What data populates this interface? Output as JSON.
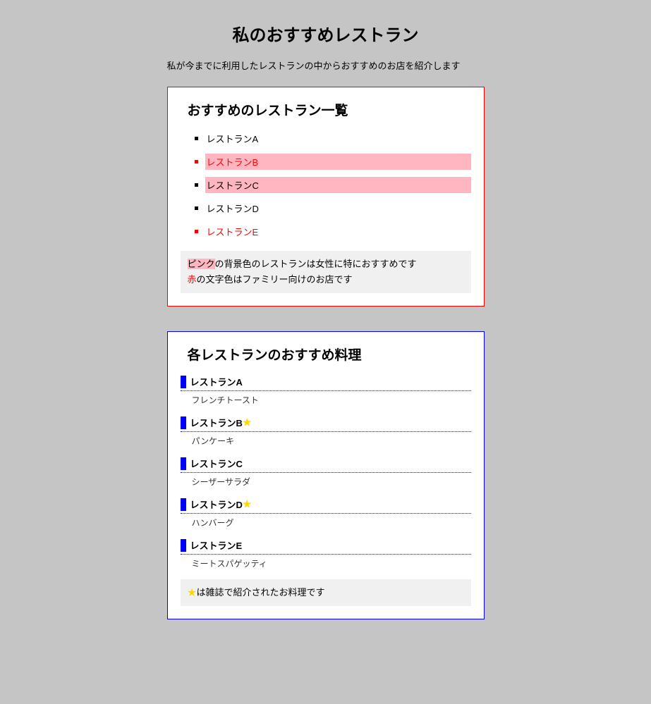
{
  "title": "私のおすすめレストラン",
  "intro": "私が今までに利用したレストランの中からおすすめのお店を紹介します",
  "section1": {
    "heading": "おすすめのレストラン一覧",
    "items": [
      {
        "name": "レストランA",
        "pinkBg": false,
        "redText": false
      },
      {
        "name": "レストランB",
        "pinkBg": true,
        "redText": true
      },
      {
        "name": "レストランC",
        "pinkBg": true,
        "redText": false
      },
      {
        "name": "レストランD",
        "pinkBg": false,
        "redText": false
      },
      {
        "name": "レストランE",
        "pinkBg": false,
        "redText": true
      }
    ],
    "note": {
      "pinkWord": "ピンク",
      "line1Rest": "の背景色のレストランは女性に特におすすめです",
      "redWord": "赤",
      "line2Rest": "の文字色はファミリー向けのお店です"
    }
  },
  "section2": {
    "heading": "各レストランのおすすめ料理",
    "items": [
      {
        "name": "レストランA",
        "dish": "フレンチトースト",
        "starred": false
      },
      {
        "name": "レストランB",
        "dish": "パンケーキ",
        "starred": true
      },
      {
        "name": "レストランC",
        "dish": "シーザーサラダ",
        "starred": false
      },
      {
        "name": "レストランD",
        "dish": "ハンバーグ",
        "starred": true
      },
      {
        "name": "レストランE",
        "dish": "ミートスパゲッティ",
        "starred": false
      }
    ],
    "note": {
      "star": "★",
      "rest": "は雑誌で紹介されたお料理です"
    }
  }
}
